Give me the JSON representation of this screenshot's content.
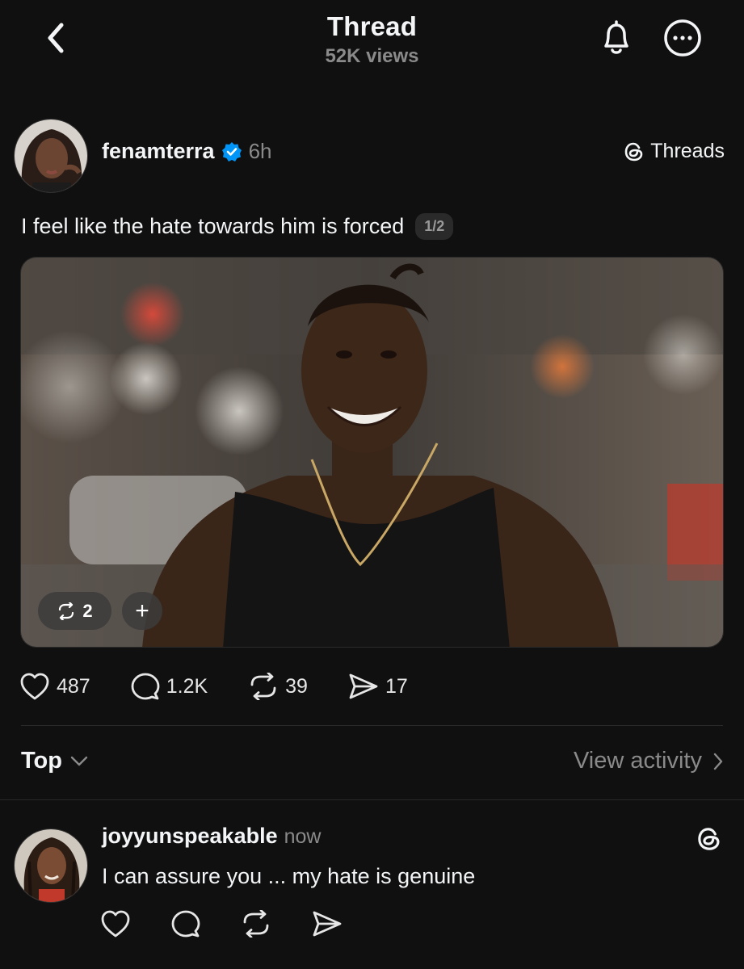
{
  "header": {
    "title": "Thread",
    "views": "52K views"
  },
  "post": {
    "username": "fenamterra",
    "timestamp": "6h",
    "source_label": "Threads",
    "text": "I feel like the hate towards him is forced",
    "page_badge": "1/2",
    "media_chip_count": "2",
    "media_chip_plus": "+",
    "likes": "487",
    "replies": "1.2K",
    "reposts": "39",
    "shares": "17"
  },
  "sort": {
    "label": "Top",
    "activity_label": "View activity"
  },
  "reply": {
    "username": "joyyunspeakable",
    "timestamp": "now",
    "text": "I can assure you ... my hate is genuine"
  },
  "colors": {
    "background": "#101010",
    "text": "#f3f5f7",
    "secondary_text": "#8a8a8a",
    "verified_blue": "#0095f6",
    "divider": "#2a2a2a"
  },
  "icons": [
    "back-chevron-icon",
    "bell-icon",
    "more-icon",
    "verified-icon",
    "threads-logo-icon",
    "heart-icon",
    "comment-icon",
    "repost-icon",
    "share-icon",
    "chevron-down-icon",
    "chevron-right-icon"
  ]
}
